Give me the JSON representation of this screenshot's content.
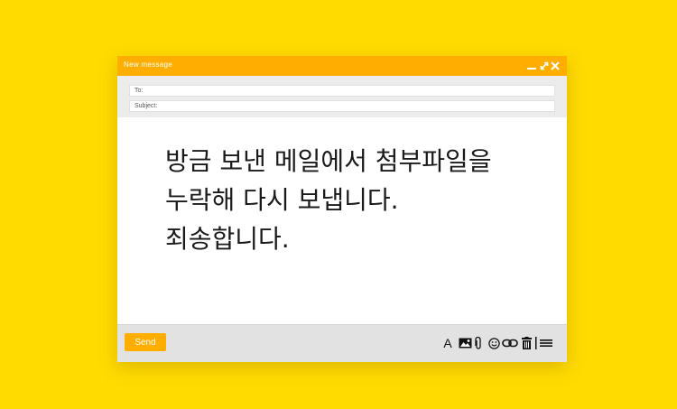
{
  "window": {
    "title": "New  message"
  },
  "fields": {
    "to_label": "To:",
    "subject_label": "Subject:"
  },
  "body": {
    "lines": [
      "방금 보낸 메일에서 첨부파일을",
      "누락해 다시 보냅니다.",
      "죄송합니다."
    ]
  },
  "footer": {
    "send_label": "Send",
    "format_text_glyph": "A"
  },
  "icons": {
    "window_controls": [
      "minimize-icon",
      "maximize-icon",
      "close-icon"
    ],
    "toolbar": [
      "format-text-icon",
      "insert-image-icon",
      "attach-icon",
      "emoji-icon",
      "link-icon",
      "trash-icon",
      "more-options-icon"
    ]
  },
  "colors": {
    "background": "#FFDB00",
    "accent": "#FFAE00",
    "window": "#FFFFFF",
    "header": "#ECECEC",
    "footer": "#E2E2E2"
  }
}
